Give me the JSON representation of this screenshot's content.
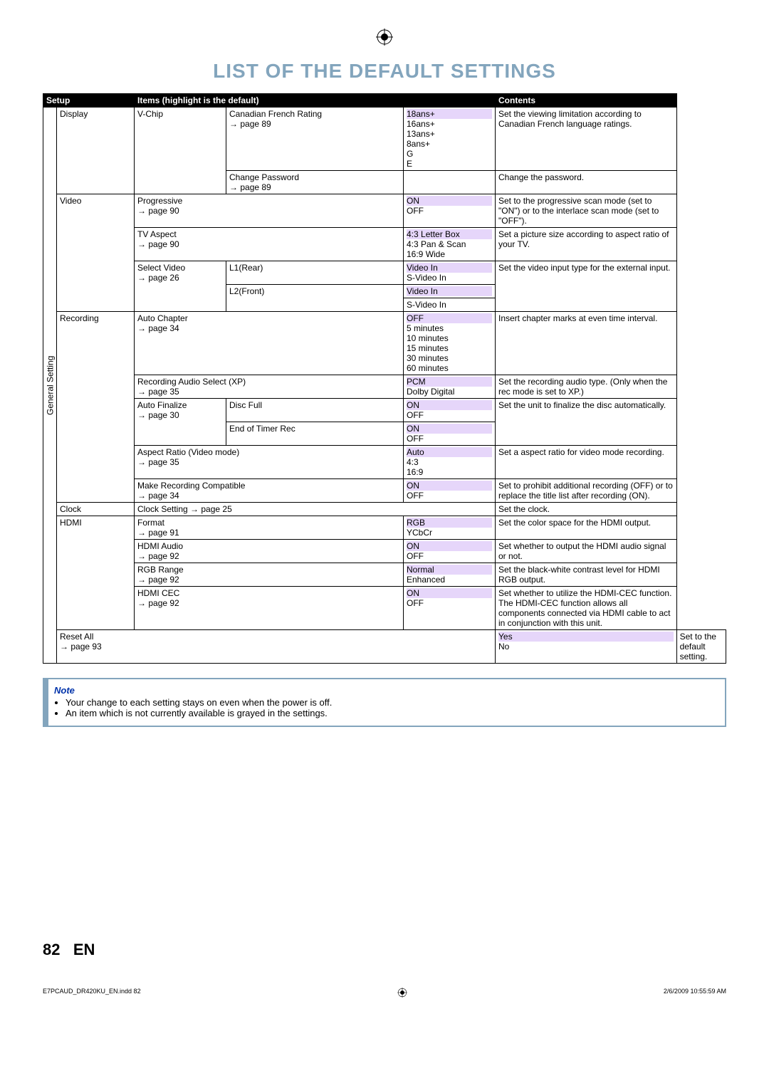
{
  "title": "LIST OF THE DEFAULT SETTINGS",
  "header": {
    "setup": "Setup",
    "items": "Items (highlight is the default)",
    "contents": "Contents"
  },
  "vertText": "General Setting",
  "display": {
    "label": "Display",
    "vchip": "V-Chip",
    "cfr": {
      "label": "Canadian French Rating",
      "page": "page 89",
      "opts": [
        "18ans+",
        "16ans+",
        "13ans+",
        "8ans+",
        "G",
        "E"
      ],
      "desc": "Set the viewing limitation according to Canadian French language ratings."
    },
    "cpw": {
      "label": "Change Password",
      "page": "page 89",
      "desc": "Change the password."
    }
  },
  "video": {
    "label": "Video",
    "prog": {
      "label": "Progressive",
      "page": "page 90",
      "opts": [
        "ON",
        "OFF"
      ],
      "desc": "Set to the progressive scan mode (set to \"ON\") or to the interlace scan mode (set to \"OFF\")."
    },
    "tva": {
      "label": "TV Aspect",
      "page": "page 90",
      "opts": [
        "4:3 Letter Box",
        "4:3 Pan & Scan",
        "16:9 Wide"
      ],
      "desc": "Set a picture size according to aspect ratio of your TV."
    },
    "sel": {
      "label": "Select Video",
      "page": "page 26",
      "l1": "L1(Rear)",
      "l2": "L2(Front)",
      "l1opts": [
        "Video In",
        "S-Video In"
      ],
      "l2opts": [
        "Video In",
        "S-Video In"
      ],
      "desc": "Set the video input type for the external input."
    }
  },
  "rec": {
    "label": "Recording",
    "ac": {
      "label": "Auto Chapter",
      "page": "page 34",
      "opts": [
        "OFF",
        "5 minutes",
        "10 minutes",
        "15 minutes",
        "30 minutes",
        "60 minutes"
      ],
      "desc": "Insert chapter marks at even time interval."
    },
    "ras": {
      "label": "Recording Audio Select (XP)",
      "page": "page 35",
      "opts": [
        "PCM",
        "Dolby Digital"
      ],
      "desc": "Set the recording audio type. (Only when the rec mode is set to XP.)"
    },
    "af": {
      "label": "Auto Finalize",
      "page": "page 30",
      "df": "Disc Full",
      "dfopts": [
        "ON",
        "OFF"
      ],
      "et": "End of Timer Rec",
      "etopts": [
        "ON",
        "OFF"
      ],
      "desc": "Set the unit to finalize the disc automatically."
    },
    "ar": {
      "label": "Aspect Ratio (Video mode)",
      "page": "page 35",
      "opts": [
        "Auto",
        "4:3",
        "16:9"
      ],
      "desc": "Set a aspect ratio for video mode recording."
    },
    "mrc": {
      "label": "Make Recording Compatible",
      "page": "page 34",
      "opts": [
        "ON",
        "OFF"
      ],
      "desc": "Set to prohibit additional recording (OFF) or to replace the title list after recording (ON)."
    }
  },
  "clock": {
    "label": "Clock",
    "cs": "Clock Setting → page 25",
    "desc": "Set the clock."
  },
  "hdmi": {
    "label": "HDMI",
    "fmt": {
      "label": "Format",
      "page": "page 91",
      "opts": [
        "RGB",
        "YCbCr"
      ],
      "desc": "Set the color space for the HDMI output."
    },
    "aud": {
      "label": "HDMI Audio",
      "page": "page 92",
      "opts": [
        "ON",
        "OFF"
      ],
      "desc": "Set whether to output the HDMI audio signal or not."
    },
    "rgb": {
      "label": "RGB Range",
      "page": "page 92",
      "opts": [
        "Normal",
        "Enhanced"
      ],
      "desc": "Set the black-white contrast level for HDMI RGB output."
    },
    "cec": {
      "label": "HDMI CEC",
      "page": "page 92",
      "opts": [
        "ON",
        "OFF"
      ],
      "desc": "Set whether to utilize the HDMI-CEC function. The HDMI-CEC function allows all components connected via HDMI cable to act in conjunction with this unit."
    }
  },
  "reset": {
    "label": "Reset All",
    "page": "page 93",
    "opts": [
      "Yes",
      "No"
    ],
    "desc": "Set to the default setting."
  },
  "note": {
    "title": "Note",
    "i1": "Your change to each setting stays on even when the power is off.",
    "i2": "An item which is not currently available is grayed in the settings."
  },
  "pgnum": "82",
  "en": "EN",
  "footer": {
    "left": "E7PCAUD_DR420KU_EN.indd   82",
    "right": "2/6/2009   10:55:59 AM"
  }
}
